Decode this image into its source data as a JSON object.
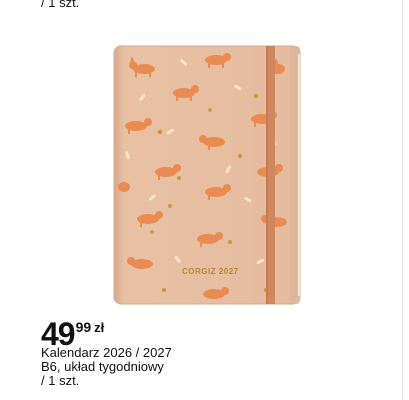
{
  "top_note": "/ 1 szt.",
  "product": {
    "image_alt": "Kalendarz z wzorem corgi",
    "cover_text": "CORGIZ 2027",
    "colors": {
      "cover": "#e7c0a3",
      "band": "#d48a5e",
      "corgi": "#e98d54"
    },
    "price": {
      "integer": "49",
      "decimals": "99",
      "currency": "zł"
    },
    "description": [
      "Kalendarz 2026 / 2027",
      "B6, układ tygodniowy",
      "/ 1 szt."
    ]
  }
}
